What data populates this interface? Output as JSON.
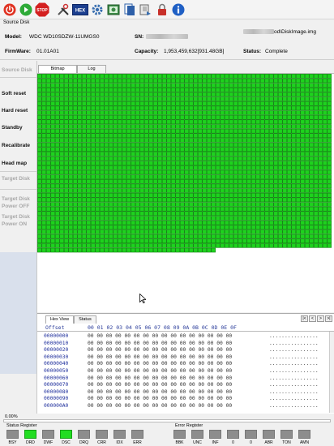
{
  "toolbar": {
    "buttons": [
      {
        "name": "power-icon",
        "color": "#e03222"
      },
      {
        "name": "start-icon",
        "color": "#2eaa38"
      },
      {
        "name": "stop-icon",
        "color": "#d42020",
        "label": "STOP"
      },
      {
        "name": "tools-icon",
        "color": "#444444"
      },
      {
        "name": "hex-icon",
        "color": "#1c3f8f",
        "label": "HEX"
      },
      {
        "name": "settings-icon",
        "color": "#3a6fb0"
      },
      {
        "name": "image-icon",
        "color": "#3c8b46"
      },
      {
        "name": "copy-icon",
        "color": "#2d5fa8"
      },
      {
        "name": "export-icon",
        "color": "#3a6fb0"
      },
      {
        "name": "lock-icon",
        "color": "#c8302a"
      },
      {
        "name": "info-icon",
        "color": "#1f5fc4"
      }
    ]
  },
  "info": {
    "section_label": "Source Disk",
    "model_label": "Model:",
    "model_value": "WDC WD10SDZW-11UMGS0",
    "firmware_label": "FirmWare:",
    "firmware_value": "01.01A01",
    "sn_label": "SN:",
    "capacity_label": "Capacity:",
    "capacity_value": "1,953,459,632[931.48GB]",
    "image_path_suffix": "od\\DiskImage.img",
    "status_label": "Status:",
    "status_value": "Complete"
  },
  "left_panel": {
    "source_disk": "Source Disk",
    "soft_reset": "Soft reset",
    "hard_reset": "Hard reset",
    "standby": "Standby",
    "recalibrate": "Recalibrate",
    "head_map": "Head map",
    "target_disk": "Target Disk",
    "target_power_off_1": "Target Disk",
    "target_power_off_2": "Power OFF",
    "target_power_on_1": "Target Disk",
    "target_power_on_2": "Power ON"
  },
  "tabs": [
    "Bitmap",
    "Log"
  ],
  "bitmap": {
    "cell_color": "#1ed21e",
    "cell_border": "#0a7a0a",
    "empty_color": "#ffffff"
  },
  "hex": {
    "tabs": [
      "Hex View",
      "Status"
    ],
    "offset_header": "Offset",
    "column_headers": "00 01 02 03 04 05 06 07 08 09 0A 0B 0C 0D 0E 0F",
    "nav": [
      "|<",
      "<",
      ">",
      ">|"
    ],
    "rows": [
      {
        "offset": "00000000",
        "bytes": "00 00 00 00 00 00 00 00 00 00 00 00 00 00 00 00",
        "ascii": "................"
      },
      {
        "offset": "00000010",
        "bytes": "00 00 00 00 00 00 00 00 00 00 00 00 00 00 00 00",
        "ascii": "................"
      },
      {
        "offset": "00000020",
        "bytes": "00 00 00 00 00 00 00 00 00 00 00 00 00 00 00 00",
        "ascii": "................"
      },
      {
        "offset": "00000030",
        "bytes": "00 00 00 00 00 00 00 00 00 00 00 00 00 00 00 00",
        "ascii": "................"
      },
      {
        "offset": "00000040",
        "bytes": "00 00 00 00 00 00 00 00 00 00 00 00 00 00 00 00",
        "ascii": "................"
      },
      {
        "offset": "00000050",
        "bytes": "00 00 00 00 00 00 00 00 00 00 00 00 00 00 00 00",
        "ascii": "................"
      },
      {
        "offset": "00000060",
        "bytes": "00 00 00 00 00 00 00 00 00 00 00 00 00 00 00 00",
        "ascii": "................"
      },
      {
        "offset": "00000070",
        "bytes": "00 00 00 00 00 00 00 00 00 00 00 00 00 00 00 00",
        "ascii": "................"
      },
      {
        "offset": "00000080",
        "bytes": "00 00 00 00 00 00 00 00 00 00 00 00 00 00 00 00",
        "ascii": "................"
      },
      {
        "offset": "00000090",
        "bytes": "00 00 00 00 00 00 00 00 00 00 00 00 00 00 00 00",
        "ascii": "................"
      },
      {
        "offset": "000000A0",
        "bytes": "00 00 00 00 00 00 00 00 00 00 00 00 00 00 00 00",
        "ascii": "................"
      }
    ]
  },
  "progress": {
    "percent_text": "0.00%",
    "percent": 0
  },
  "status_register": {
    "title": "Status Register",
    "leds": [
      {
        "label": "BSY",
        "on": false
      },
      {
        "label": "DRD",
        "on": true
      },
      {
        "label": "DWF",
        "on": false
      },
      {
        "label": "DSC",
        "on": true
      },
      {
        "label": "DRQ",
        "on": false
      },
      {
        "label": "CRR",
        "on": false
      },
      {
        "label": "IDX",
        "on": false
      },
      {
        "label": "ERR",
        "on": false
      }
    ]
  },
  "error_register": {
    "title": "Error Register",
    "leds": [
      {
        "label": "BBK",
        "on": false
      },
      {
        "label": "UNC",
        "on": false
      },
      {
        "label": "INF",
        "on": false
      },
      {
        "label": "0",
        "on": false
      },
      {
        "label": "0",
        "on": false
      },
      {
        "label": "ABR",
        "on": false
      },
      {
        "label": "TON",
        "on": false
      },
      {
        "label": "AMN",
        "on": false
      }
    ]
  },
  "colors": {
    "led_on": "#22dd22",
    "led_off": "#8d8d8d",
    "accent_blue": "#2d2d9a"
  }
}
